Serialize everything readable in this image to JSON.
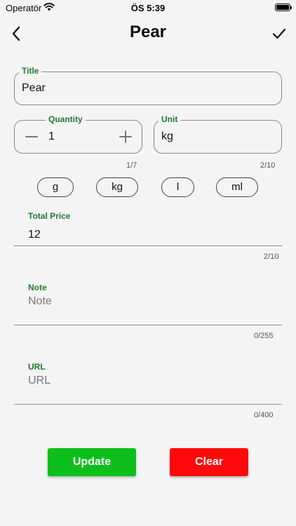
{
  "status_bar": {
    "carrier": "Operatör",
    "time": "ÖS 5:39"
  },
  "nav": {
    "title": "Pear"
  },
  "form": {
    "title_field": {
      "label": "Title",
      "value": "Pear"
    },
    "quantity_field": {
      "label": "Quantity",
      "value": "1",
      "counter": "1/7"
    },
    "unit_field": {
      "label": "Unit",
      "value": "kg",
      "counter": "2/10"
    },
    "unit_chips": [
      "g",
      "kg",
      "l",
      "ml"
    ],
    "total_price_field": {
      "label": "Total Price",
      "value": "12",
      "counter": "2/10"
    },
    "note_field": {
      "label": "Note",
      "placeholder": "Note",
      "counter": "0/255"
    },
    "url_field": {
      "label": "URL",
      "placeholder": "URL",
      "counter": "0/400"
    }
  },
  "actions": {
    "update_label": "Update",
    "clear_label": "Clear"
  },
  "colors": {
    "accent_label": "#1e7a32",
    "update": "#0dbf1a",
    "clear": "#ff0a0a",
    "background": "#f4f4f4"
  }
}
